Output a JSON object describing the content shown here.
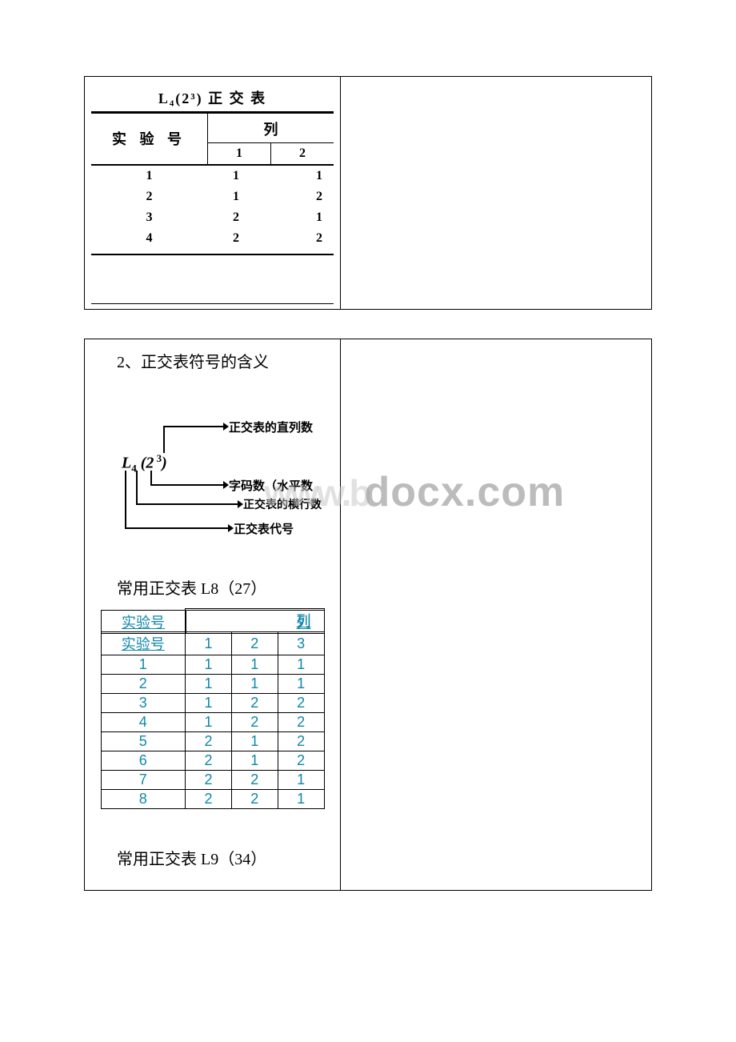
{
  "table1": {
    "title": "L₄(2³) 正 交 表",
    "exp_header": "实 验 号",
    "cols_header": "列",
    "cols": [
      "1",
      "2"
    ],
    "rows": [
      {
        "exp": "1",
        "vals": [
          "1",
          "1"
        ]
      },
      {
        "exp": "2",
        "vals": [
          "1",
          "2"
        ]
      },
      {
        "exp": "3",
        "vals": [
          "2",
          "1"
        ]
      },
      {
        "exp": "4",
        "vals": [
          "2",
          "2"
        ]
      }
    ]
  },
  "section2": {
    "title": "2、正交表符号的含义",
    "diagram": {
      "formula_l": "L",
      "formula_sub": "4",
      "formula_paren_open": " (2",
      "formula_sup": " 3",
      "formula_paren_close": ")",
      "label_top": "正交表的直列数",
      "label_mid1": "字码数（水平数",
      "label_mid2": "正交表的横行数",
      "label_bottom": "正交表代号"
    },
    "l8_title": "常用正交表 L8（27）",
    "l8_table": {
      "exp_header": "实验号",
      "cols_header": "列",
      "cols": [
        "1",
        "2",
        "3"
      ],
      "rows": [
        {
          "exp": "1",
          "vals": [
            "1",
            "1",
            "1"
          ]
        },
        {
          "exp": "2",
          "vals": [
            "1",
            "1",
            "1"
          ]
        },
        {
          "exp": "3",
          "vals": [
            "1",
            "2",
            "2"
          ]
        },
        {
          "exp": "4",
          "vals": [
            "1",
            "2",
            "2"
          ]
        },
        {
          "exp": "5",
          "vals": [
            "2",
            "1",
            "2"
          ]
        },
        {
          "exp": "6",
          "vals": [
            "2",
            "1",
            "2"
          ]
        },
        {
          "exp": "7",
          "vals": [
            "2",
            "2",
            "1"
          ]
        },
        {
          "exp": "8",
          "vals": [
            "2",
            "2",
            "1"
          ]
        }
      ]
    },
    "l9_title": "常用正交表 L9（34）"
  },
  "watermark": {
    "prefix": "www.b",
    "main": "docx.com"
  }
}
